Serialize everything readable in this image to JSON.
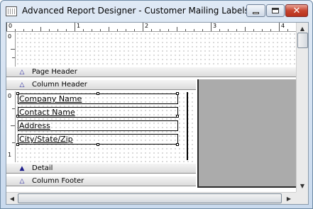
{
  "window": {
    "title": "Advanced Report Designer - Customer Mailing Labels",
    "app_icon": "report-icon"
  },
  "title_buttons": {
    "minimize_icon": "minimize-icon",
    "maximize_icon": "maximize-icon",
    "close_icon": "close-icon",
    "close_glyph": "✕"
  },
  "ruler": {
    "h_labels": [
      "0",
      "1",
      "2",
      "3",
      "4"
    ],
    "v_top_labels": [
      "0"
    ],
    "v_bottom_labels": [
      "0",
      "1"
    ]
  },
  "sections": {
    "page_header": "Page Header",
    "column_header": "Column Header",
    "detail": "Detail",
    "column_footer": "Column Footer"
  },
  "fields": [
    "Company Name",
    "Contact Name",
    "Address",
    "City/State/Zip"
  ],
  "colors": {
    "section_triangle": "#2a2aa0",
    "gray_area": "#ababab",
    "close_button": "#c7452f"
  }
}
